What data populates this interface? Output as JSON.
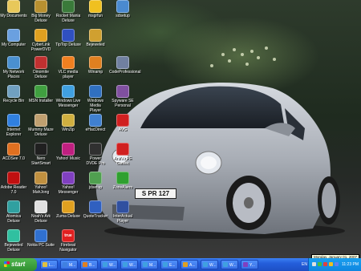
{
  "desktop": {
    "icons": [
      {
        "label": "My Documents",
        "icon": "folder-icon",
        "color": "#e8c85a"
      },
      {
        "label": "Big Money\nDeluxe",
        "icon": "money-bag-icon",
        "color": "#b89030"
      },
      {
        "label": "Rocket Mania\nDeluxe",
        "icon": "rocket-icon",
        "color": "#3a7a3a"
      },
      {
        "label": "msgrfun",
        "icon": "smiley-icon",
        "color": "#f0c020"
      },
      {
        "label": "sdsetup",
        "icon": "setup-icon",
        "color": "#4a8ad0"
      },
      {
        "label": "My Computer",
        "icon": "computer-icon",
        "color": "#6aa0e0"
      },
      {
        "label": "CyberLink\nPowerDVD",
        "icon": "dvd-icon",
        "color": "#e0a020"
      },
      {
        "label": "TipTop Deluxe",
        "icon": "game-icon",
        "color": "#3050c0"
      },
      {
        "label": "Bejeweled",
        "icon": "trophy-icon",
        "color": "#d0a030"
      },
      {
        "label": "My Network\nPlaces",
        "icon": "network-icon",
        "color": "#4a90d0"
      },
      {
        "label": "Dinomite\nDeluxe",
        "icon": "dinosaur-icon",
        "color": "#c03030"
      },
      {
        "label": "VLC media\nplayer",
        "icon": "vlc-cone-icon",
        "color": "#f08020"
      },
      {
        "label": "Winamp",
        "icon": "winamp-icon",
        "color": "#e08020"
      },
      {
        "label": "CodeProfessional",
        "icon": "code-icon",
        "color": "#7080a0"
      },
      {
        "label": "Recycle Bin",
        "icon": "recycle-bin-icon",
        "color": "#70a0c0"
      },
      {
        "label": "MSN Installer",
        "icon": "msn-butterfly-icon",
        "color": "#40a040"
      },
      {
        "label": "Windows Live\nMessenger",
        "icon": "messenger-icon",
        "color": "#40a0e0"
      },
      {
        "label": "Windows Media\nPlayer",
        "icon": "media-player-icon",
        "color": "#3070c0"
      },
      {
        "label": "Spyware SE\nPersonal",
        "icon": "spyware-icon",
        "color": "#8050a0"
      },
      {
        "label": "Internet\nExplorer",
        "icon": "internet-explorer-icon",
        "color": "#3080e0"
      },
      {
        "label": "Mummy Maze\nDeluxe",
        "icon": "mummy-icon",
        "color": "#c0a070"
      },
      {
        "label": "WinZip",
        "icon": "winzip-icon",
        "color": "#d0b040"
      },
      {
        "label": "eHacDirect",
        "icon": "document-icon",
        "color": "#4080d0"
      },
      {
        "label": "AVG",
        "icon": "avg-icon",
        "color": "#d02020"
      },
      {
        "label": "ACDSee 7.0",
        "icon": "acdsee-icon",
        "color": "#e07020"
      },
      {
        "label": "Nero\nStartSmart",
        "icon": "nero-icon",
        "color": "#202020"
      },
      {
        "label": "Yahoo! Music",
        "icon": "yahoo-music-icon",
        "color": "#c02080"
      },
      {
        "label": "Power\nDVDE Pro",
        "icon": "power-dvd-icon",
        "color": "#303030"
      },
      {
        "label": "AntiVir PE\nClassic",
        "icon": "antivir-icon",
        "color": "#d02020"
      },
      {
        "label": "Adobe Reader\n7.0",
        "icon": "adobe-reader-icon",
        "color": "#c01010"
      },
      {
        "label": "Yahoo!\nMahJong",
        "icon": "mahjong-icon",
        "color": "#c09040"
      },
      {
        "label": "Yahoo!\nMessenger",
        "icon": "yahoo-messenger-icon",
        "color": "#8040c0"
      },
      {
        "label": "jdsetup",
        "icon": "setup-icon",
        "color": "#50a050"
      },
      {
        "label": "ZoneAlarm",
        "icon": "zonealarm-icon",
        "color": "#30a030"
      },
      {
        "label": "Atomica Deluxe",
        "icon": "atom-icon",
        "color": "#30a0a0"
      },
      {
        "label": "Noah's Ark\nDeluxe",
        "icon": "dove-icon",
        "color": "#e0e0e0"
      },
      {
        "label": "Zuma Deluxe",
        "icon": "zuma-icon",
        "color": "#e0a020"
      },
      {
        "label": "QuoteTracker",
        "icon": "quote-tracker-icon",
        "color": "#3060c0"
      },
      {
        "label": "InterActual\nPlayer",
        "icon": "dvd-player-icon",
        "color": "#3050a0"
      },
      {
        "label": "Bejeweled\nDeluxe",
        "icon": "gem-icon",
        "color": "#30c0a0"
      },
      {
        "label": "Nokia PC Suite",
        "icon": "nokia-icon",
        "color": "#3070d0"
      },
      {
        "label": "Firebeat\nNavigator",
        "icon": "true-logo-icon",
        "color": "#e02020",
        "badge": "true"
      }
    ],
    "license_plate": "S PR 127"
  },
  "taskbar": {
    "start_label": "start",
    "tasks": [
      {
        "label": "L...",
        "color": "#e0c040"
      },
      {
        "label": "M...",
        "color": "#4080e0"
      },
      {
        "label": "B...",
        "color": "#e08020"
      },
      {
        "label": "W...",
        "color": "#40a0e0"
      },
      {
        "label": "W...",
        "color": "#40a0e0"
      },
      {
        "label": "M...",
        "color": "#40a0e0"
      },
      {
        "label": "E...",
        "color": "#40a0e0"
      },
      {
        "label": "A...",
        "color": "#e0a020"
      },
      {
        "label": "W...",
        "color": "#40a0e0"
      },
      {
        "label": "W...",
        "color": "#40a0e0"
      },
      {
        "label": "Y...",
        "color": "#8040c0"
      }
    ],
    "language": "EN",
    "clock": "11:23 PM",
    "tooltip": "Monday, January 01, 2007",
    "tray_icons": [
      "#e0e0e0",
      "#40c040",
      "#e04040",
      "#f0c020",
      "#6080f0"
    ]
  },
  "colors": {
    "taskbar": "#245edb",
    "start": "#3a9e3a",
    "tray": "#0f86e0"
  }
}
